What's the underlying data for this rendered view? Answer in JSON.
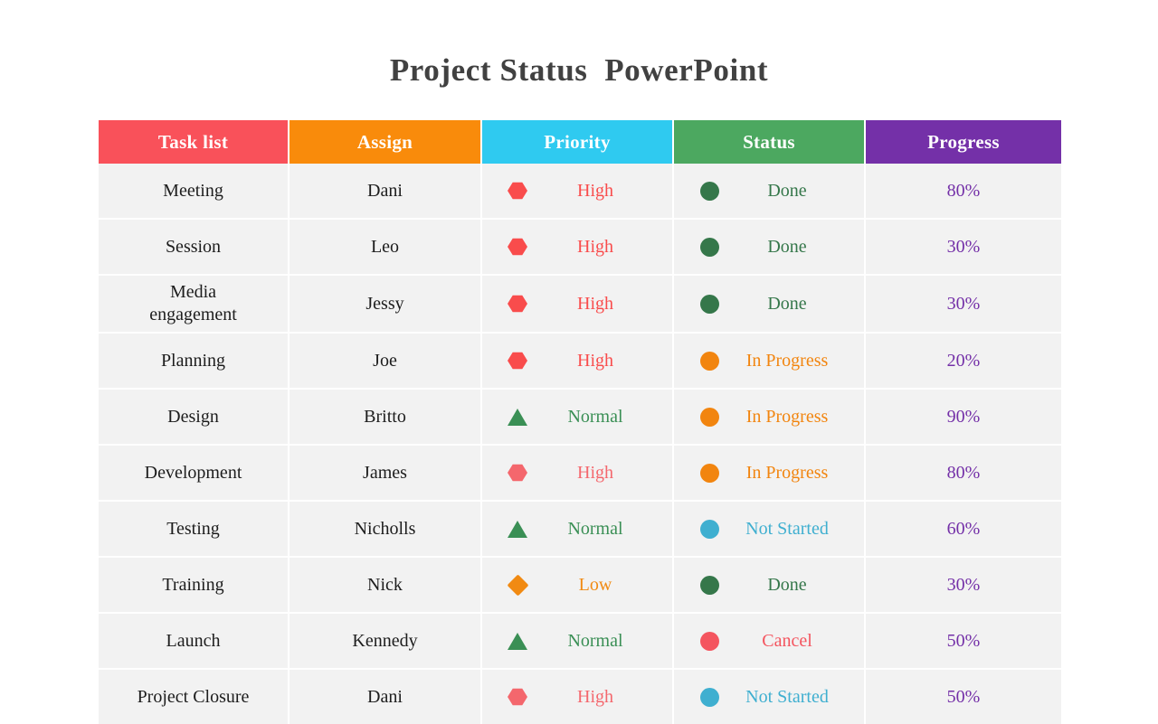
{
  "slide": {
    "title": "Project Status  PowerPoint",
    "background": "#ffffff"
  },
  "palette": {
    "title_text": "#414141",
    "header_task": "#f9515a",
    "header_assign": "#f98b0b",
    "header_priority": "#2fcaf0",
    "header_status": "#4ca860",
    "header_progress": "#7430a8",
    "row_background": "#f2f2f2",
    "row_text": "#1d1d1d",
    "priority_high": "#f94c4c",
    "priority_high_soft": "#f4676d",
    "priority_normal": "#3a8f55",
    "priority_low": "#f18a12",
    "status_done": "#35774a",
    "status_in_progress": "#f2850f",
    "status_not_started": "#3fafd0",
    "status_cancel": "#f4555f",
    "progress_text": "#7430a8"
  },
  "table": {
    "columns": [
      {
        "key": "task",
        "label": "Task list"
      },
      {
        "key": "assign",
        "label": "Assign"
      },
      {
        "key": "priority",
        "label": "Priority"
      },
      {
        "key": "status",
        "label": "Status"
      },
      {
        "key": "progress",
        "label": "Progress"
      }
    ],
    "rows": [
      {
        "task": "Meeting",
        "assign": "Dani",
        "priority": {
          "label": "High",
          "icon": "hexagon-icon",
          "color": "#f94c4c"
        },
        "status": {
          "label": "Done",
          "icon": "circle-icon",
          "color": "#35774a"
        },
        "progress": "80%"
      },
      {
        "task": "Session",
        "assign": "Leo",
        "priority": {
          "label": "High",
          "icon": "hexagon-icon",
          "color": "#f94c4c"
        },
        "status": {
          "label": "Done",
          "icon": "circle-icon",
          "color": "#35774a"
        },
        "progress": "30%"
      },
      {
        "task": "Media\nengagement",
        "assign": "Jessy",
        "priority": {
          "label": "High",
          "icon": "hexagon-icon",
          "color": "#f94c4c"
        },
        "status": {
          "label": "Done",
          "icon": "circle-icon",
          "color": "#35774a"
        },
        "progress": "30%"
      },
      {
        "task": "Planning",
        "assign": "Joe",
        "priority": {
          "label": "High",
          "icon": "hexagon-icon",
          "color": "#f94c4c"
        },
        "status": {
          "label": "In Progress",
          "icon": "circle-icon",
          "color": "#f2850f"
        },
        "progress": "20%"
      },
      {
        "task": "Design",
        "assign": "Britto",
        "priority": {
          "label": "Normal",
          "icon": "triangle-icon",
          "color": "#3a8f55"
        },
        "status": {
          "label": "In Progress",
          "icon": "circle-icon",
          "color": "#f2850f"
        },
        "progress": "90%"
      },
      {
        "task": "Development",
        "assign": "James",
        "priority": {
          "label": "High",
          "icon": "hexagon-icon",
          "color": "#f4676d"
        },
        "status": {
          "label": "In Progress",
          "icon": "circle-icon",
          "color": "#f2850f"
        },
        "progress": "80%"
      },
      {
        "task": "Testing",
        "assign": "Nicholls",
        "priority": {
          "label": "Normal",
          "icon": "triangle-icon",
          "color": "#3a8f55"
        },
        "status": {
          "label": "Not Started",
          "icon": "circle-icon",
          "color": "#3fafd0"
        },
        "progress": "60%"
      },
      {
        "task": "Training",
        "assign": "Nick",
        "priority": {
          "label": "Low",
          "icon": "diamond-icon",
          "color": "#f18a12"
        },
        "status": {
          "label": "Done",
          "icon": "circle-icon",
          "color": "#35774a"
        },
        "progress": "30%"
      },
      {
        "task": "Launch",
        "assign": "Kennedy",
        "priority": {
          "label": "Normal",
          "icon": "triangle-icon",
          "color": "#3a8f55"
        },
        "status": {
          "label": "Cancel",
          "icon": "circle-icon",
          "color": "#f4555f"
        },
        "progress": "50%"
      },
      {
        "task": "Project  Closure",
        "assign": "Dani",
        "priority": {
          "label": "High",
          "icon": "hexagon-icon",
          "color": "#f4676d"
        },
        "status": {
          "label": "Not Started",
          "icon": "circle-icon",
          "color": "#3fafd0"
        },
        "progress": "50%"
      }
    ]
  }
}
